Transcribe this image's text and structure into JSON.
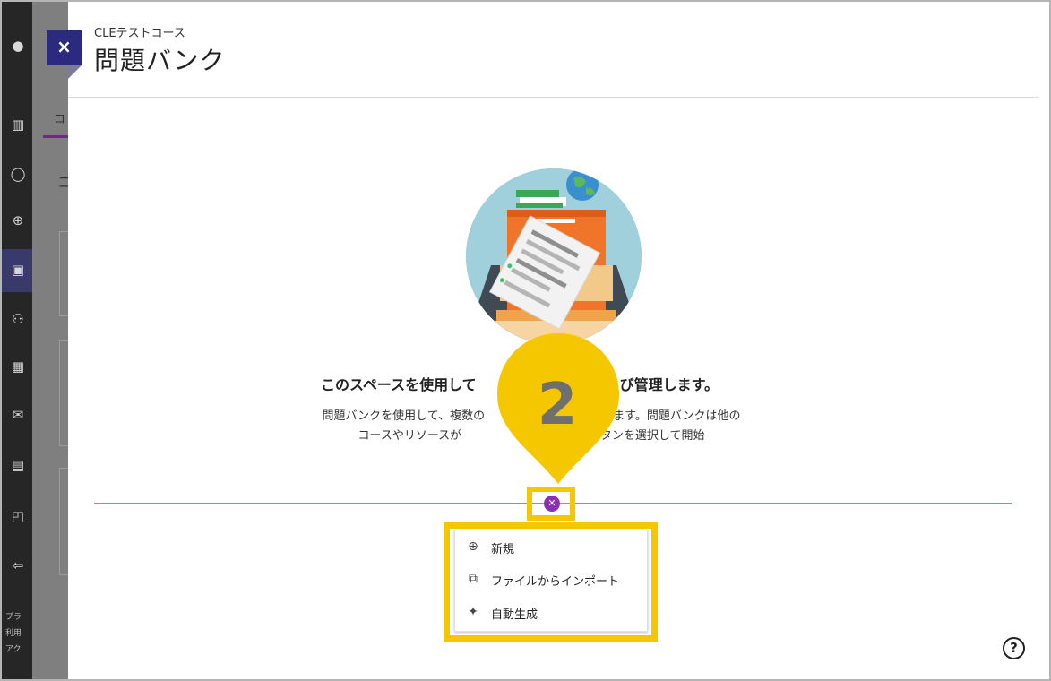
{
  "header": {
    "course_name": "CLEテストコース",
    "title": "問題バンク",
    "close_label": "×"
  },
  "background_page": {
    "tab_label_fragment": "コ",
    "heading_fragment": "コ",
    "footer_lines": [
      "プラ",
      "利用",
      "アク"
    ]
  },
  "main": {
    "heading": "このスペースを使用して　　　　　　作成および管理します。",
    "description": "問題バンクを使用して、複数の　　　　　　を共有できます。問題バンクは他のコースやリソースが　　　　　きます。下のボタンを選択して開始"
  },
  "add_button_icon": "close-circle-icon",
  "callout": {
    "number": "2",
    "color": "#f5c700"
  },
  "menu": {
    "items": [
      {
        "icon": "plus-circle-icon",
        "label": "新規"
      },
      {
        "icon": "import-icon",
        "label": "ファイルからインポート"
      },
      {
        "icon": "sparkle-icon",
        "label": "自動生成"
      }
    ]
  },
  "help": {
    "icon": "help-circle-icon",
    "label": "?"
  },
  "colors": {
    "accent_purple": "#8b2fb5",
    "close_button": "#2b2a7e",
    "highlight": "#f5c700"
  }
}
